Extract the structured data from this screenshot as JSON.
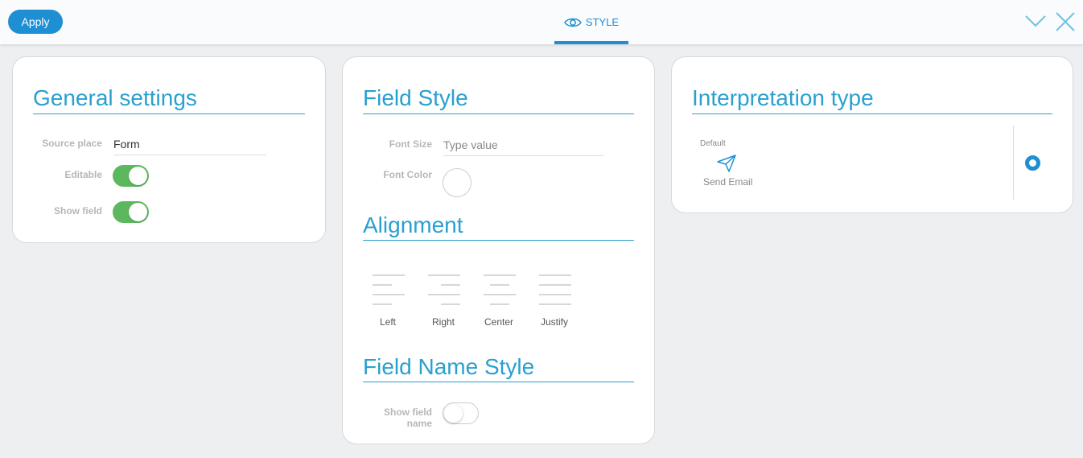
{
  "toolbar": {
    "apply_label": "Apply",
    "tab_label": "STYLE"
  },
  "general": {
    "title": "General settings",
    "source_place_label": "Source place",
    "source_place_value": "Form",
    "editable_label": "Editable",
    "editable_on": true,
    "show_field_label": "Show field",
    "show_field_on": true
  },
  "field_style": {
    "title": "Field Style",
    "font_size_label": "Font Size",
    "font_size_placeholder": "Type value",
    "font_color_label": "Font Color",
    "alignment_title": "Alignment",
    "alignments": [
      "Left",
      "Right",
      "Center",
      "Justify"
    ],
    "name_style_title": "Field Name Style",
    "show_field_name_label_1": "Show field",
    "show_field_name_label_2": "name",
    "show_field_name_on": false
  },
  "interpretation": {
    "title": "Interpretation type",
    "default_label": "Default",
    "option_label": "Send Email",
    "option_icon": "paper-plane-icon",
    "selected": true
  },
  "colors": {
    "accent": "#1e8fd3",
    "heading": "#2aa0cf",
    "toggle_on": "#5cb85c"
  }
}
